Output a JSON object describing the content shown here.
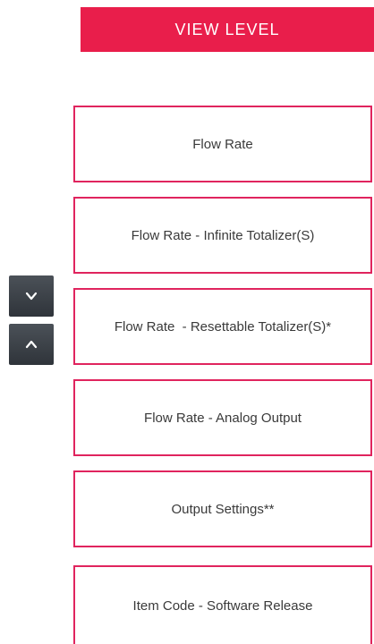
{
  "header": {
    "title": "VIEW LEVEL",
    "color": "#e91e4b"
  },
  "menu": {
    "border_color": "#e0245e",
    "items": [
      {
        "label": "Flow Rate"
      },
      {
        "label": "Flow Rate - Infinite Totalizer(S)"
      },
      {
        "label": "Flow Rate  - Resettable Totalizer(S)*"
      },
      {
        "label": "Flow Rate - Analog Output"
      },
      {
        "label": "Output Settings**"
      },
      {
        "label": "Item Code - Software Release"
      }
    ]
  },
  "nav": {
    "down_icon": "chevron-down-icon",
    "up_icon": "chevron-up-icon"
  }
}
